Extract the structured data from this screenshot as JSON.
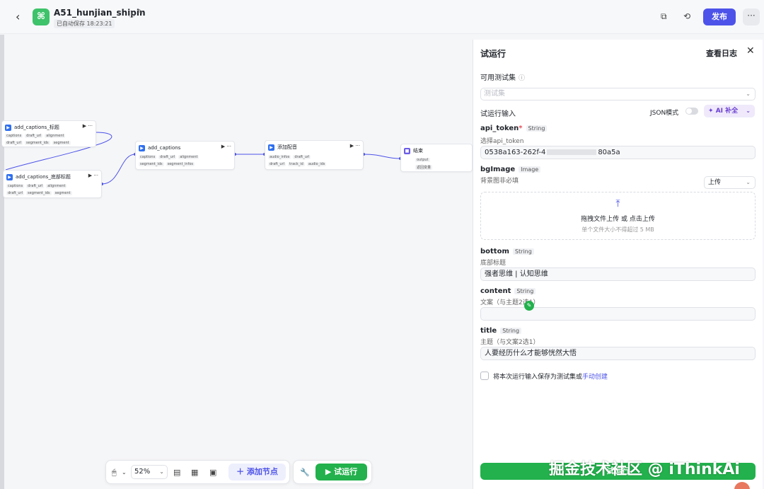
{
  "header": {
    "back_icon": "chevron-left-icon",
    "app_logo_icon": "workflow-app-icon",
    "title": "A51_hunjian_shipin",
    "autosave": "已自动保存 18:23:21",
    "publish_label": "发布",
    "more_label": "···"
  },
  "canvas": {
    "nodes": [
      {
        "title": "add_captions_标题",
        "row1": [
          "captions",
          "draft_url",
          "alignment"
        ],
        "row2": [
          "draft_url",
          "segment_ids",
          "segment"
        ]
      },
      {
        "title": "add_captions_底部标题",
        "row1": [
          "captions",
          "draft_url",
          "alignment"
        ],
        "row2": [
          "draft_url",
          "segment_ids",
          "segment"
        ]
      },
      {
        "title": "add_captions",
        "row1": [
          "captions",
          "draft_url",
          "alignment"
        ],
        "row2": [
          "segment_ids",
          "segment_infos"
        ]
      },
      {
        "title": "添加配音",
        "row1": [
          "audio_infos",
          "draft_url"
        ],
        "row2": [
          "draft_url",
          "track_id",
          "audio_ids"
        ]
      },
      {
        "title": "结束",
        "row1": [
          "output"
        ],
        "row2": [
          "返回变量"
        ]
      }
    ],
    "node_controls": "▶ ···"
  },
  "toolbar": {
    "zoom": "52%",
    "add_node_label": "添加节点",
    "run_label": "试运行"
  },
  "panel": {
    "title": "试运行",
    "view_log": "查看日志",
    "close_icon": "close-icon",
    "testset_label": "可用测试集",
    "testset_placeholder": "测试集",
    "input_label": "试运行输入",
    "json_mode_label": "JSON模式",
    "ai_fill_label": "AI 补全",
    "fields": {
      "api_token": {
        "name": "api_token",
        "type": "String",
        "desc": "选择api_token",
        "value": "0538a163-262f-4"
      },
      "api_token_suffix": "80a5a",
      "bgImage": {
        "name": "bgImage",
        "type": "Image",
        "desc": "背景图非必填",
        "upload_mode": "上传",
        "upload_main": "拖拽文件上传 或 点击上传",
        "upload_sub": "单个文件大小不得超过 5 MB"
      },
      "bottom": {
        "name": "bottom",
        "type": "String",
        "desc": "底部标题",
        "value": "强者思维 | 认知思维"
      },
      "content": {
        "name": "content",
        "type": "String",
        "desc": "文案（与主题2选1）",
        "value": ""
      },
      "title": {
        "name": "title",
        "type": "String",
        "desc": "主题（与文案2选1）",
        "value": "人要经历什么才能够恍然大悟"
      }
    },
    "save_prefix": "将本次运行输入保存为测试集或",
    "save_link": "手动创建",
    "run_button": "试运行"
  },
  "watermark": "掘金技术社区 @ iThinkAi",
  "colors": {
    "brand": "#4d53e8",
    "run_green": "#22b14c",
    "ai_purple": "#6a3fd1"
  }
}
